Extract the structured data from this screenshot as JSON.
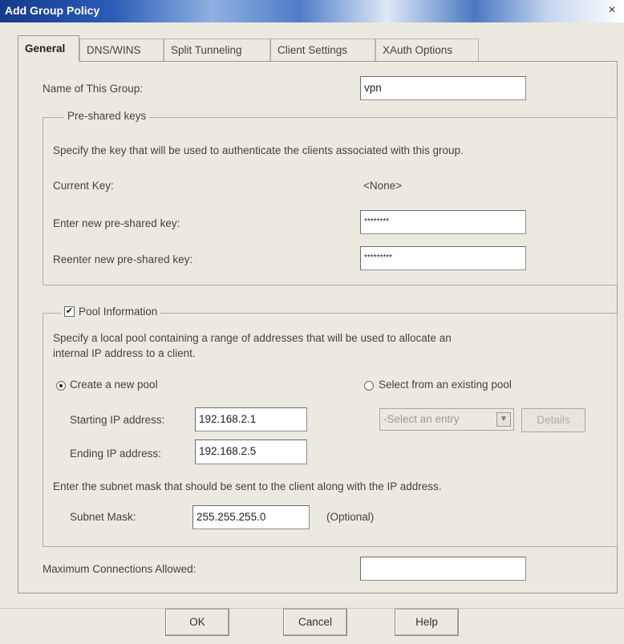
{
  "window": {
    "title": "Add Group Policy",
    "close_glyph": "×"
  },
  "tabs": [
    {
      "label": "General",
      "active": true
    },
    {
      "label": "DNS/WINS"
    },
    {
      "label": "Split Tunneling"
    },
    {
      "label": "Client Settings"
    },
    {
      "label": "XAuth Options"
    }
  ],
  "general": {
    "group_name_label": "Name of This Group:",
    "group_name_value": "vpn",
    "psk": {
      "legend": "Pre-shared keys",
      "description": "Specify the key that will be used to authenticate the clients associated with this group.",
      "current_key_label": "Current Key:",
      "current_key_value": "<None>",
      "new_key_label": "Enter new pre-shared key:",
      "new_key_value": "********",
      "reenter_key_label": "Reenter new pre-shared key:",
      "reenter_key_value": "*********"
    },
    "pool": {
      "legend": "Pool Information",
      "checked": true,
      "check_glyph": "✔",
      "description_line1": "Specify a local pool containing a range of addresses that will be used to allocate an",
      "description_line2": "internal IP address to a client.",
      "create_new_label": "Create a new pool",
      "select_existing_label": "Select from an existing pool",
      "starting_ip_label": "Starting IP address:",
      "starting_ip_value": "192.168.2.1",
      "ending_ip_label": "Ending IP address:",
      "ending_ip_value": "192.168.2.5",
      "select_placeholder": "-Select an entry",
      "select_arrow_glyph": "▼",
      "details_button": "Details",
      "subnet_description": "Enter the subnet mask that should be sent to the client along with the IP address.",
      "subnet_label": "Subnet Mask:",
      "subnet_value": "255.255.255.0",
      "subnet_optional": "(Optional)"
    },
    "max_connections_label": "Maximum Connections Allowed:",
    "max_connections_value": ""
  },
  "buttons": {
    "ok": "OK",
    "cancel": "Cancel",
    "help": "Help"
  }
}
